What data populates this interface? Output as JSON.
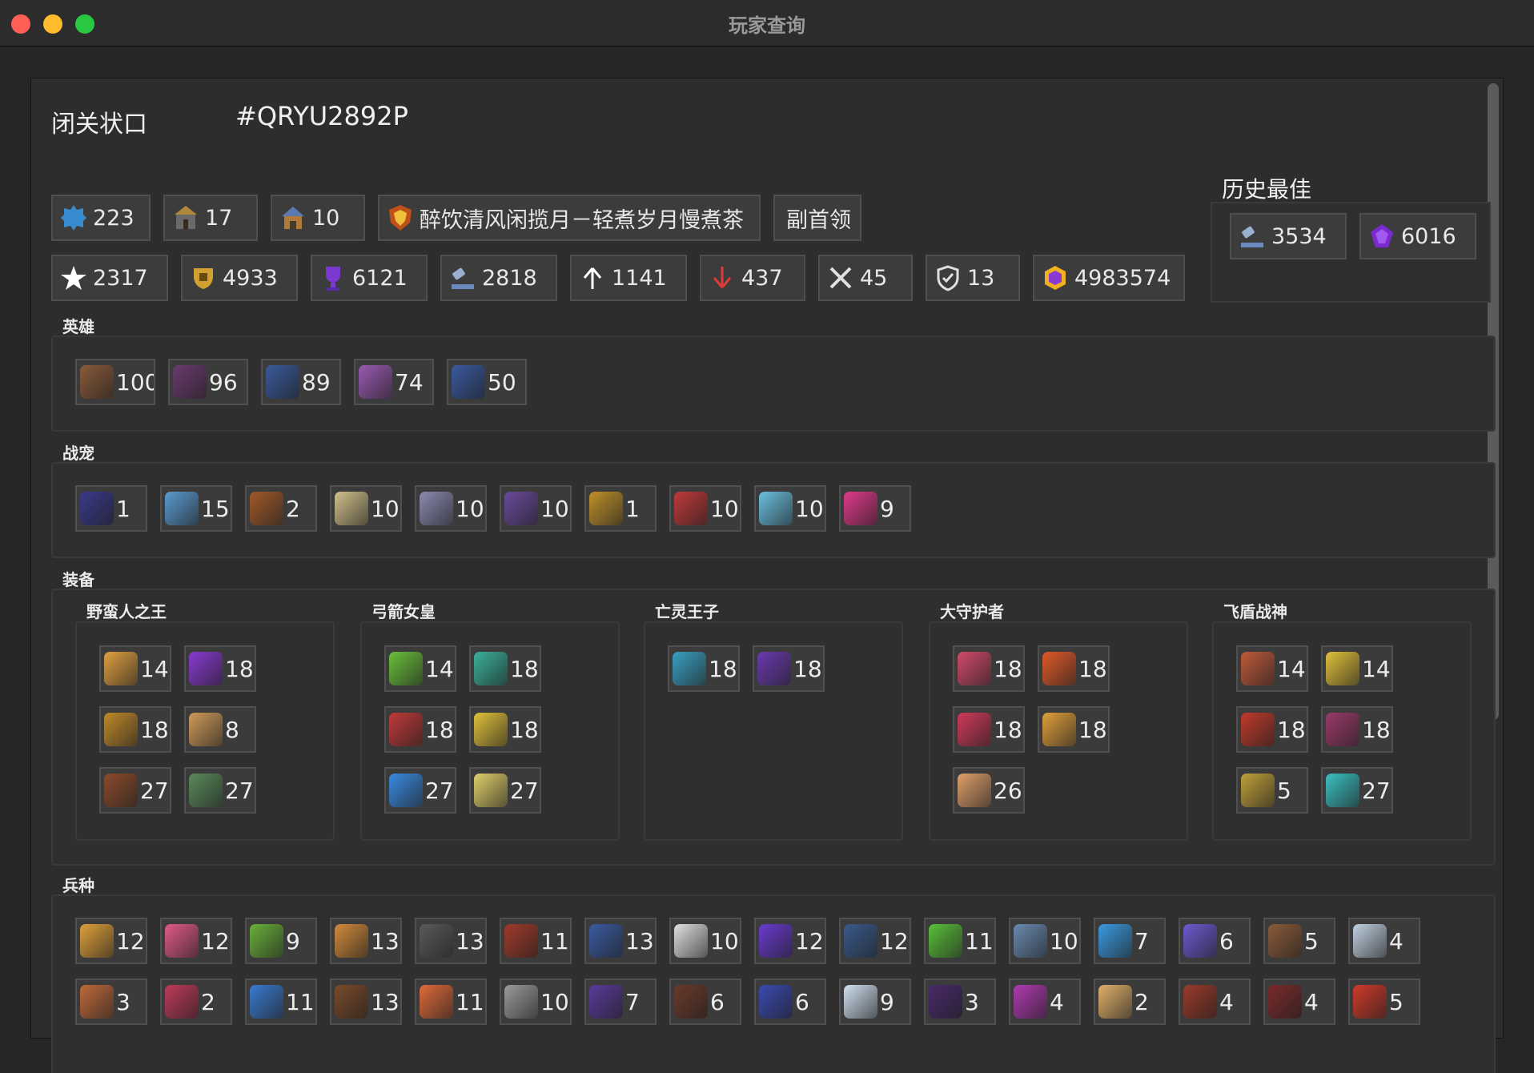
{
  "window": {
    "title": "玩家查询"
  },
  "player": {
    "name": "闭关状口",
    "tag": "#QRYU2892P"
  },
  "badges_row1": [
    {
      "icon": "xp-level-icon",
      "value": "223"
    },
    {
      "icon": "town-hall-icon",
      "value": "17"
    },
    {
      "icon": "builder-hall-icon",
      "value": "10"
    },
    {
      "icon": "clan-badge-icon",
      "value": "醉饮清风闲揽月－轻煮岁月慢煮茶"
    },
    {
      "icon": "",
      "value": "副首领"
    }
  ],
  "badges_row2": [
    {
      "icon": "star-icon",
      "value": "2317"
    },
    {
      "icon": "legend-trophy-icon",
      "value": "4933"
    },
    {
      "icon": "trophy-icon",
      "value": "6121"
    },
    {
      "icon": "builder-trophy-icon",
      "value": "2818"
    },
    {
      "icon": "arrow-up-icon",
      "value": "1141"
    },
    {
      "icon": "arrow-down-icon",
      "value": "437"
    },
    {
      "icon": "crossed-swords-icon",
      "value": "45"
    },
    {
      "icon": "shield-icon",
      "value": "13"
    },
    {
      "icon": "capital-gold-icon",
      "value": "4983574"
    }
  ],
  "best": {
    "label": "历史最佳",
    "items": [
      {
        "icon": "builder-trophy-icon",
        "value": "3534"
      },
      {
        "icon": "gem-trophy-icon",
        "value": "6016"
      }
    ]
  },
  "heroes": {
    "label": "英雄",
    "items": [
      {
        "name": "barbarian-king",
        "value": "100",
        "color": "#8a5a3a"
      },
      {
        "name": "archer-queen",
        "value": "96",
        "color": "#6b3b6e"
      },
      {
        "name": "minion-prince",
        "value": "89",
        "color": "#3a5a9a"
      },
      {
        "name": "grand-warden",
        "value": "74",
        "color": "#9a5ab0"
      },
      {
        "name": "royal-champion",
        "value": "50",
        "color": "#3a5aa0"
      }
    ]
  },
  "pets": {
    "label": "战宠",
    "items": [
      {
        "name": "pet-1",
        "value": "1",
        "color": "#3a3a8a"
      },
      {
        "name": "pet-2",
        "value": "15",
        "color": "#5a9ad0"
      },
      {
        "name": "pet-3",
        "value": "2",
        "color": "#a05a2a"
      },
      {
        "name": "pet-4",
        "value": "10",
        "color": "#d0c08a"
      },
      {
        "name": "pet-5",
        "value": "10",
        "color": "#8a8ab0"
      },
      {
        "name": "pet-6",
        "value": "10",
        "color": "#6a4a9a"
      },
      {
        "name": "pet-7",
        "value": "1",
        "color": "#c0902a"
      },
      {
        "name": "pet-8",
        "value": "10",
        "color": "#c03a3a"
      },
      {
        "name": "pet-9",
        "value": "10",
        "color": "#6ac0e0"
      },
      {
        "name": "pet-10",
        "value": "9",
        "color": "#e03a8a"
      }
    ]
  },
  "equipment": {
    "label": "装备",
    "groups": [
      {
        "title": "野蛮人之王",
        "items": [
          {
            "value": "14",
            "color": "#e0a040"
          },
          {
            "value": "18",
            "color": "#8a3ad0"
          },
          {
            "value": "18",
            "color": "#c08a2a"
          },
          {
            "value": "8",
            "color": "#d09a5a"
          },
          {
            "value": "27",
            "color": "#8a4a2a"
          },
          {
            "value": "27",
            "color": "#5a8a5a"
          }
        ]
      },
      {
        "title": "弓箭女皇",
        "items": [
          {
            "value": "14",
            "color": "#6ac03a"
          },
          {
            "value": "18",
            "color": "#3ab09a"
          },
          {
            "value": "18",
            "color": "#c03a3a"
          },
          {
            "value": "18",
            "color": "#e0c03a"
          },
          {
            "value": "27",
            "color": "#3a8ae0"
          },
          {
            "value": "27",
            "color": "#e0d06a"
          }
        ]
      },
      {
        "title": "亡灵王子",
        "items": [
          {
            "value": "18",
            "color": "#3aa0c0"
          },
          {
            "value": "18",
            "color": "#6a3ab0"
          }
        ]
      },
      {
        "title": "大守护者",
        "items": [
          {
            "value": "18",
            "color": "#d04a6a"
          },
          {
            "value": "18",
            "color": "#e05a2a"
          },
          {
            "value": "18",
            "color": "#d03a5a"
          },
          {
            "value": "18",
            "color": "#e0a03a"
          },
          {
            "value": "26",
            "color": "#e0a06a"
          }
        ]
      },
      {
        "title": "飞盾战神",
        "items": [
          {
            "value": "14",
            "color": "#c05a3a"
          },
          {
            "value": "14",
            "color": "#e0c03a"
          },
          {
            "value": "18",
            "color": "#c03a2a"
          },
          {
            "value": "18",
            "color": "#9a3a6a"
          },
          {
            "value": "5",
            "color": "#c0a03a"
          },
          {
            "value": "27",
            "color": "#3ac0c0"
          }
        ]
      }
    ]
  },
  "troops": {
    "label": "兵种",
    "items": [
      {
        "value": "12",
        "color": "#e0a03a"
      },
      {
        "value": "12",
        "color": "#e05a8a"
      },
      {
        "value": "9",
        "color": "#6ab03a"
      },
      {
        "value": "13",
        "color": "#d08a3a"
      },
      {
        "value": "13",
        "color": "#5a5a5a"
      },
      {
        "value": "11",
        "color": "#a03a2a"
      },
      {
        "value": "13",
        "color": "#3a5aa0"
      },
      {
        "value": "10",
        "color": "#e0e0e0"
      },
      {
        "value": "12",
        "color": "#6a3ad0"
      },
      {
        "value": "12",
        "color": "#3a5a8a"
      },
      {
        "value": "11",
        "color": "#5ac03a"
      },
      {
        "value": "10",
        "color": "#6a8ab0"
      },
      {
        "value": "7",
        "color": "#3a9ae0"
      },
      {
        "value": "6",
        "color": "#6a5ad0"
      },
      {
        "value": "5",
        "color": "#8a5a3a"
      },
      {
        "value": "4",
        "color": "#c0d0e0"
      },
      {
        "value": "3",
        "color": "#c06a3a"
      },
      {
        "value": "2",
        "color": "#c03a5a"
      },
      {
        "value": "11",
        "color": "#3a7ad0"
      },
      {
        "value": "13",
        "color": "#7a4a2a"
      },
      {
        "value": "11",
        "color": "#e06a3a"
      },
      {
        "value": "10",
        "color": "#9a9a9a"
      },
      {
        "value": "7",
        "color": "#5a3a9a"
      },
      {
        "value": "6",
        "color": "#6a3a2a"
      },
      {
        "value": "6",
        "color": "#3a4ab0"
      },
      {
        "value": "9",
        "color": "#d0e0f0"
      },
      {
        "value": "3",
        "color": "#4a2a6a"
      },
      {
        "value": "4",
        "color": "#b03ab0"
      },
      {
        "value": "2",
        "color": "#e0b06a"
      },
      {
        "value": "4",
        "color": "#9a3a2a"
      },
      {
        "value": "4",
        "color": "#7a2a2a"
      },
      {
        "value": "5",
        "color": "#d03a2a"
      }
    ]
  }
}
